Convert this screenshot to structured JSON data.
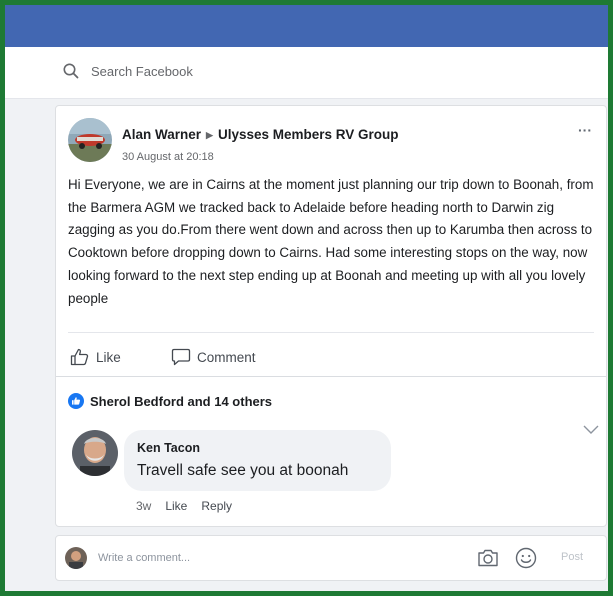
{
  "search": {
    "placeholder": "Search Facebook"
  },
  "post": {
    "author": "Alan Warner",
    "group": "Ulysses Members RV Group",
    "date": "30 August at 20:18",
    "text": "Hi Everyone, we are in Cairns at the moment just planning our trip down to Boonah, from the Barmera AGM we tracked back to Adelaide before heading north to Darwin zig zagging as you do.From there went down and across then up to Karumba then across to Cooktown before dropping down to Cairns. Had some interesting stops on the way, now looking forward to the next step ending up at Boonah and meeting up with all you lovely people",
    "more_label": "···"
  },
  "actions": {
    "like": "Like",
    "comment": "Comment"
  },
  "reactions": {
    "summary": "Sherol Bedford and 14 others"
  },
  "comment": {
    "author": "Ken Tacon",
    "text": "Travell safe see you at boonah",
    "time": "3w",
    "like": "Like",
    "reply": "Reply"
  },
  "compose": {
    "placeholder": "Write a comment...",
    "post_label": "Post"
  },
  "colors": {
    "topbar": "#4267b2",
    "frame": "#1e7a34",
    "like_blue": "#1877f2"
  },
  "icons": [
    "search-icon",
    "thumbs-up-icon",
    "comment-icon",
    "like-reaction-icon",
    "chevron-down-icon",
    "camera-icon",
    "emoji-icon"
  ]
}
